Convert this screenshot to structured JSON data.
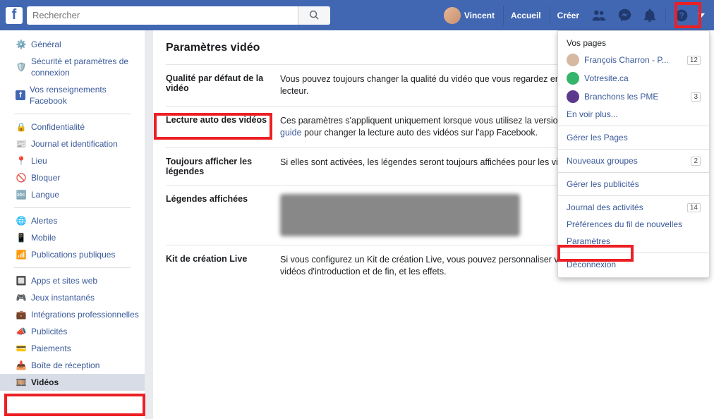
{
  "search": {
    "placeholder": "Rechercher"
  },
  "user": "Vincent",
  "nav": {
    "home": "Accueil",
    "create": "Créer"
  },
  "sidebar": {
    "items": [
      "Général",
      "Sécurité et paramètres de connexion",
      "Vos renseignements Facebook",
      "Confidentialité",
      "Journal et identification",
      "Lieu",
      "Bloquer",
      "Langue",
      "Alertes",
      "Mobile",
      "Publications publiques",
      "Apps et sites web",
      "Jeux instantanés",
      "Intégrations professionnelles",
      "Publicités",
      "Paiements",
      "Boîte de réception",
      "Vidéos"
    ]
  },
  "page": {
    "title": "Paramètres vidéo"
  },
  "rows": [
    {
      "label": "Qualité par défaut de la vidéo",
      "text": "Vous pouvez toujours changer la qualité du vidéo que vous regardez en cliquant sur l'icône HD dans le lecteur."
    },
    {
      "label": "Lecture auto des vidéos",
      "text_a": "Ces paramètres s'appliquent uniquement lorsque vous utilisez la version Web de Facebook. ",
      "link": "Suivez ce guide",
      "text_b": " pour changer la lecture auto des vidéos sur l'app Facebook."
    },
    {
      "label": "Toujours afficher les légendes",
      "text": "Si elles sont activées, les légendes seront toujours affichées pour les vidéos, lorsque disponible."
    },
    {
      "label": "Légendes affichées",
      "text": ""
    },
    {
      "label": "Kit de création Live",
      "text": "Si vous configurez un Kit de création Live, vous pouvez personnaliser votre vidéo en direct, y compris les vidéos d'introduction et de fin, et les effets."
    }
  ],
  "menu": {
    "yourpages": "Vos pages",
    "pages": [
      {
        "name": "François Charron - P...",
        "badge": "12",
        "color": "#d7b8a0"
      },
      {
        "name": "Votresite.ca",
        "badge": "",
        "color": "#35b56b"
      },
      {
        "name": "Branchons les PME",
        "badge": "3",
        "color": "#5b3a8e"
      }
    ],
    "seemore": "En voir plus...",
    "managepages": "Gérer les Pages",
    "newgroups": "Nouveaux groupes",
    "newgroups_badge": "2",
    "manageads": "Gérer les publicités",
    "activitylog": "Journal des activités",
    "activitylog_badge": "14",
    "newsfeed": "Préférences du fil de nouvelles",
    "settings": "Paramètres",
    "logout": "Déconnexion"
  }
}
